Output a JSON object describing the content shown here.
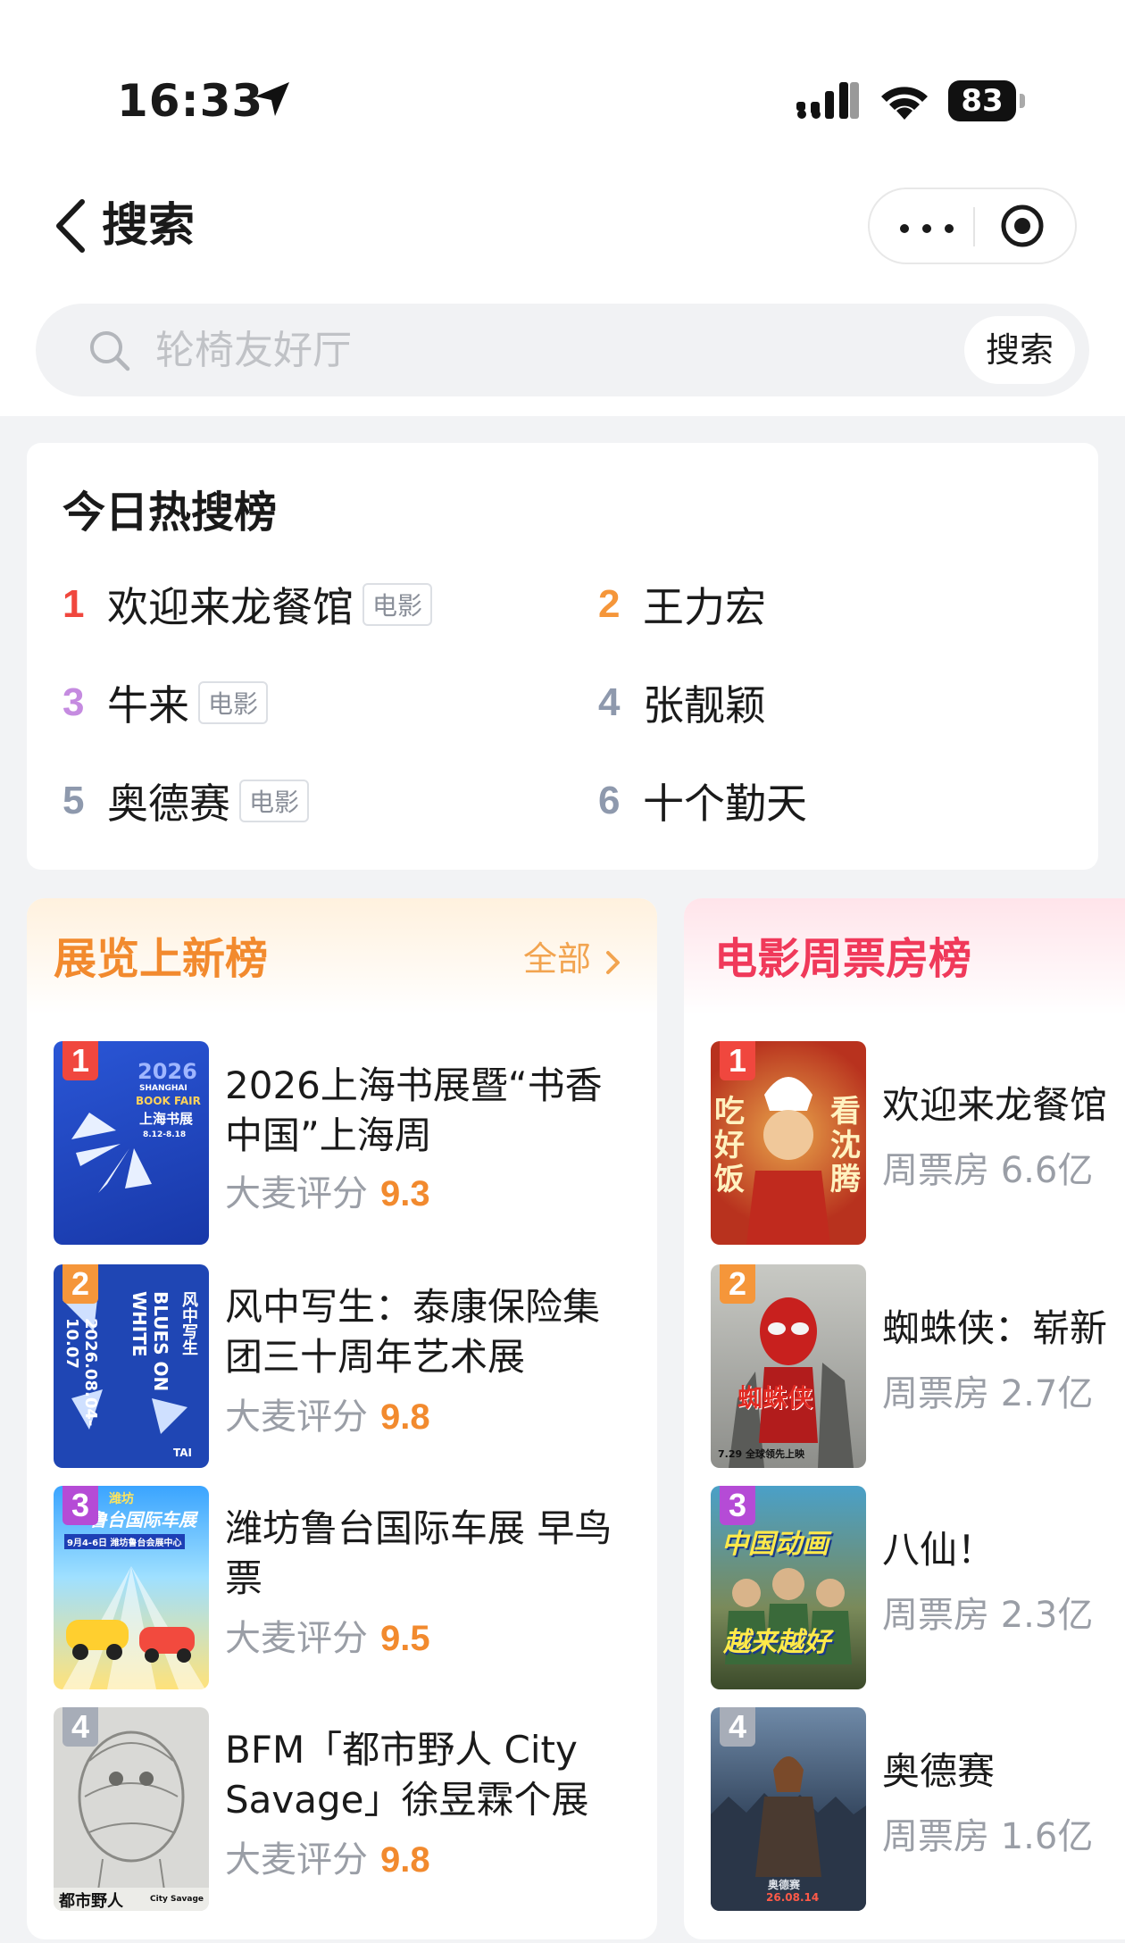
{
  "status_bar": {
    "time": "16:33",
    "battery": "83"
  },
  "nav": {
    "title": "搜索"
  },
  "search": {
    "placeholder": "轮椅友好厅",
    "button_label": "搜索"
  },
  "hot_list": {
    "title": "今日热搜榜",
    "items": [
      {
        "rank": "1",
        "name": "欢迎来龙餐馆",
        "tag": "电影",
        "color": "#f0473e"
      },
      {
        "rank": "2",
        "name": "王力宏",
        "tag": "",
        "color": "#f5963a"
      },
      {
        "rank": "3",
        "name": "牛来",
        "tag": "电影",
        "color": "#c58be0"
      },
      {
        "rank": "4",
        "name": "张靓颖",
        "tag": "",
        "color": "#8e99ad"
      },
      {
        "rank": "5",
        "name": "奥德赛",
        "tag": "电影",
        "color": "#8e99ad"
      },
      {
        "rank": "6",
        "name": "十个勤天",
        "tag": "",
        "color": "#8e99ad"
      }
    ]
  },
  "exhibitions": {
    "title": "展览上新榜",
    "all_label": "全部",
    "score_label": "大麦评分",
    "items": [
      {
        "rank": "1",
        "title": "2026上海书展暨“书香中国”上海周",
        "score": "9.3",
        "poster_lines": [
          "2026",
          "SHANGHAI",
          "BOOK FAIR",
          "上海书展",
          "8.12-8.18"
        ]
      },
      {
        "rank": "2",
        "title": "风中写生：泰康保险集团三十周年艺术展",
        "score": "9.8",
        "poster_lines": [
          "风中写生",
          "BLUES ON WHITE",
          "2026.08.04-10.07",
          "TAI"
        ]
      },
      {
        "rank": "3",
        "title": "潍坊鲁台国际车展 早鸟票",
        "score": "9.5",
        "poster_lines": [
          "潍坊",
          "鲁台国际车展",
          "9月4-6日 潍坊鲁台会展中心"
        ]
      },
      {
        "rank": "4",
        "title": "BFM「都市野人 City Savage」徐昱霖个展",
        "score": "9.8",
        "poster_lines": [
          "都市野人",
          "City Savage"
        ]
      }
    ]
  },
  "box_office": {
    "title": "电影周票房榜",
    "metric_label": "周票房",
    "items": [
      {
        "rank": "1",
        "title": "欢迎来龙餐馆",
        "value": "6.6亿",
        "poster_lines": [
          "吃好饭",
          "看沈腾"
        ]
      },
      {
        "rank": "2",
        "title": "蜘蛛侠：崭新",
        "value": "2.7亿",
        "poster_lines": [
          "蜘蛛侠",
          "7.29 全球领先上映"
        ]
      },
      {
        "rank": "3",
        "title": "八仙！",
        "value": "2.3亿",
        "poster_lines": [
          "中国动画",
          "越来越好"
        ]
      },
      {
        "rank": "4",
        "title": "奥德赛",
        "value": "1.6亿",
        "poster_lines": [
          "奥德赛",
          "26.08.14"
        ]
      }
    ]
  },
  "colors": {
    "rank_badges": [
      "#f0473e",
      "#f5963a",
      "#b54bd6",
      "#a7adb8"
    ],
    "exhibition_accent": "#f28a2e",
    "film_accent": "#f0395a"
  }
}
